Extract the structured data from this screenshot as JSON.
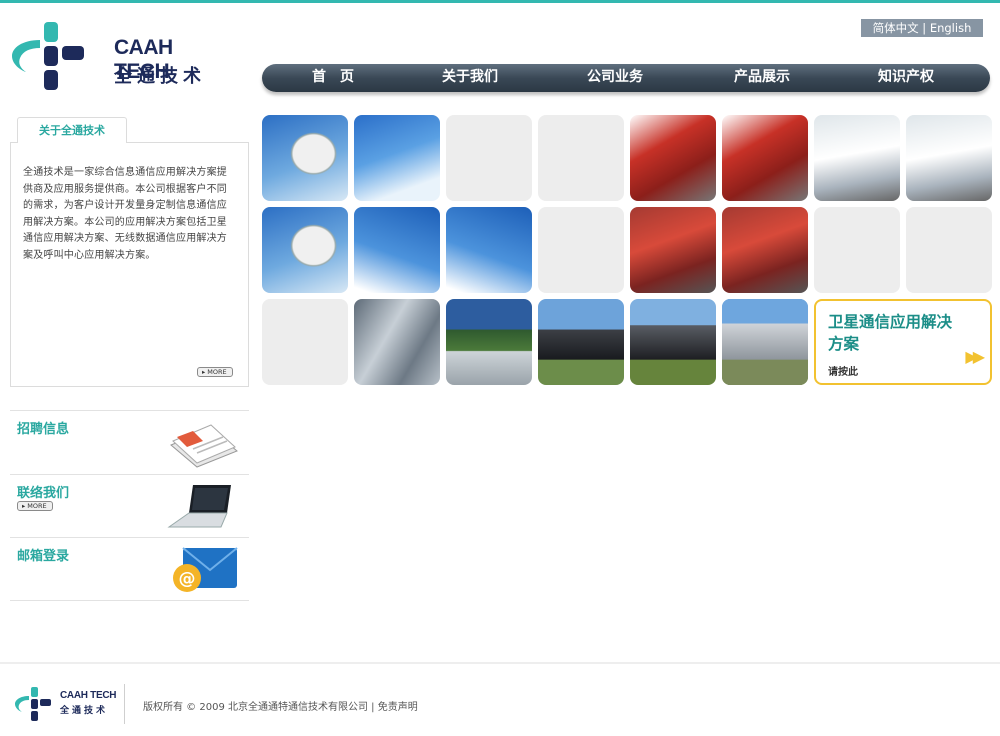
{
  "logo": {
    "en": "CAAH TECH",
    "cn": "全通技术"
  },
  "lang": {
    "chinese": "简体中文",
    "separator": "|",
    "english": "English"
  },
  "nav": {
    "items": [
      "首　页",
      "关于我们",
      "公司业务",
      "产品展示",
      "知识产权"
    ]
  },
  "about": {
    "tab": "关于全通技术",
    "text": "全通技术是一家综合信息通信应用解决方案提供商及应用服务提供商。本公司根据客户不同的需求，为客户设计开发量身定制信息通信应用解决方案。本公司的应用解决方案包括卫星通信应用解决方案、无线数据通信应用解决方案及呼叫中心应用解决方案。",
    "more": "MORE"
  },
  "side": {
    "jobs": "招聘信息",
    "contact": "联络我们",
    "contact_more": "MORE",
    "mail": "邮箱登录"
  },
  "promo": {
    "title": "卫星通信应用解决方案",
    "link": "请按此",
    "arrow": "▶▶"
  },
  "footer": {
    "logo_en": "CAAH TECH",
    "logo_cn": "全通技术",
    "text": "版权所有 © 2009 北京全通通特通信技术有限公司 | 免责声明"
  },
  "colors": {
    "accent": "#2aa8a0",
    "nav": "#3a4856",
    "promo_border": "#f2c230",
    "logo_navy": "#1d2a5a"
  }
}
